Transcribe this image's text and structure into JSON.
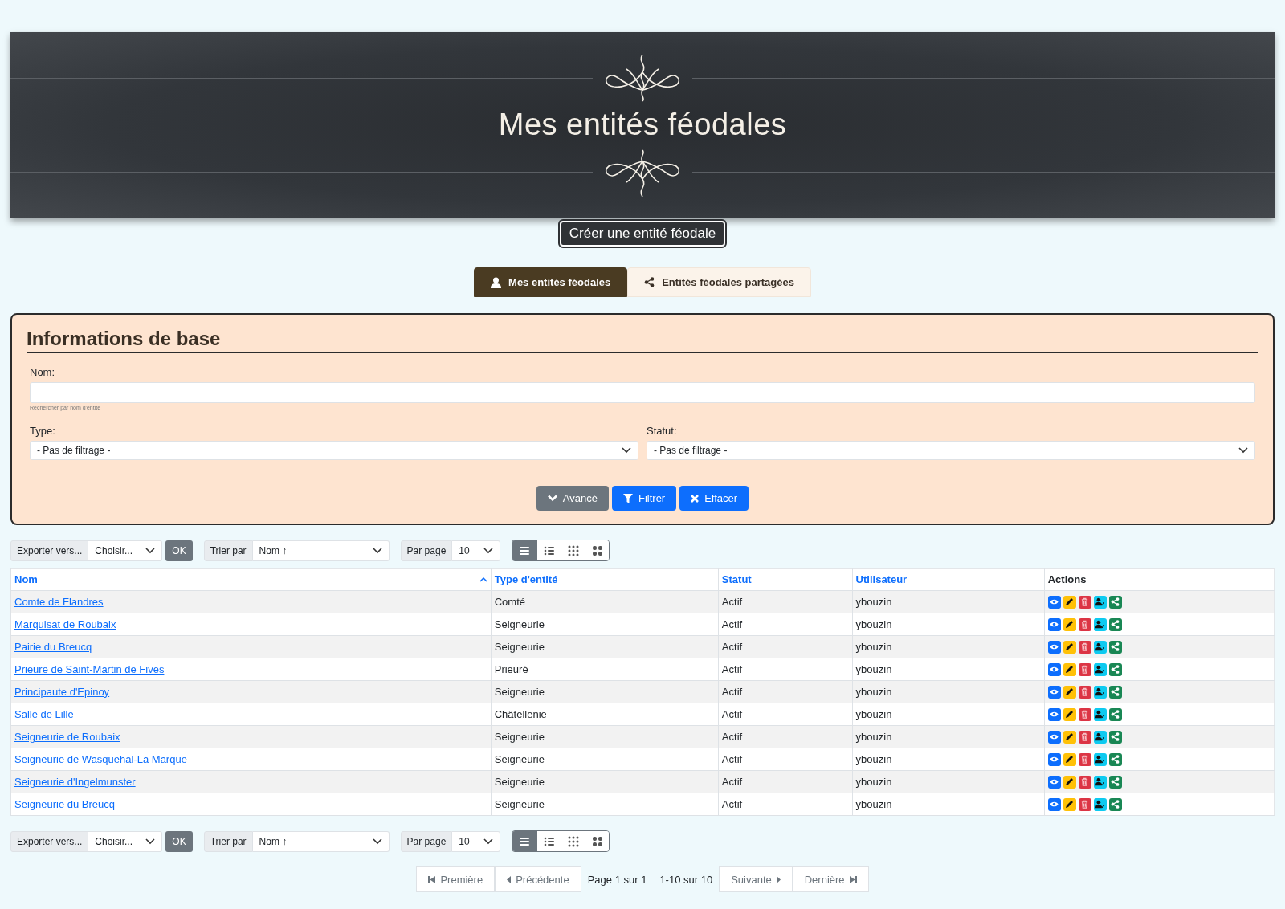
{
  "header": {
    "title": "Mes entités féodales",
    "create_button": "Créer une entité féodale"
  },
  "tabs": [
    {
      "label": "Mes entités féodales",
      "kind": "own",
      "selected": true
    },
    {
      "label": "Entités féodales partagées",
      "kind": "shared",
      "selected": false
    }
  ],
  "filter_panel": {
    "title": "Informations de base",
    "name_field": {
      "label": "Nom:",
      "help": "Rechercher par nom d'entité"
    },
    "type_field": {
      "label": "Type:",
      "value": "- Pas de filtrage -"
    },
    "status_field": {
      "label": "Statut:",
      "value": "- Pas de filtrage -"
    },
    "buttons": [
      {
        "label": "Avancé",
        "kind": "advanced"
      },
      {
        "label": "Filtrer",
        "kind": "filter"
      },
      {
        "label": "Effacer",
        "kind": "clear"
      }
    ]
  },
  "toolbars": [
    {
      "export_label": "Exporter vers...",
      "export_value": "Choisir...",
      "ok": "OK",
      "sort_label": "Trier par",
      "sort_value": "Nom ↑",
      "per_page_label": "Par page",
      "per_page_value": "10",
      "view_modes": [
        {
          "kind": "lines",
          "selected": true
        },
        {
          "kind": "list",
          "selected": false
        },
        {
          "kind": "grid-small",
          "selected": false
        },
        {
          "kind": "grid-large",
          "selected": false
        }
      ]
    },
    {
      "export_label": "Exporter vers...",
      "export_value": "Choisir...",
      "ok": "OK",
      "sort_label": "Trier par",
      "sort_value": "Nom ↑",
      "per_page_label": "Par page",
      "per_page_value": "10",
      "view_modes": [
        {
          "kind": "lines",
          "selected": true
        },
        {
          "kind": "list",
          "selected": false
        },
        {
          "kind": "grid-small",
          "selected": false
        },
        {
          "kind": "grid-large",
          "selected": false
        }
      ]
    }
  ],
  "table": {
    "columns": [
      {
        "label": "Nom",
        "sorted": true
      },
      {
        "label": "Type d'entité",
        "sorted": false
      },
      {
        "label": "Statut",
        "sorted": false
      },
      {
        "label": "Utilisateur",
        "sorted": false
      },
      {
        "label": "Actions",
        "sorted": false
      }
    ],
    "rows": [
      {
        "name": "Comte de Flandres",
        "type": "Comté",
        "status": "Actif",
        "user": "ybouzin"
      },
      {
        "name": "Marquisat de Roubaix",
        "type": "Seigneurie",
        "status": "Actif",
        "user": "ybouzin"
      },
      {
        "name": "Pairie du Breucq",
        "type": "Seigneurie",
        "status": "Actif",
        "user": "ybouzin"
      },
      {
        "name": "Prieure de Saint-Martin de Fives",
        "type": "Prieuré",
        "status": "Actif",
        "user": "ybouzin"
      },
      {
        "name": "Principaute d'Epinoy",
        "type": "Seigneurie",
        "status": "Actif",
        "user": "ybouzin"
      },
      {
        "name": "Salle de Lille",
        "type": "Châtellenie",
        "status": "Actif",
        "user": "ybouzin"
      },
      {
        "name": "Seigneurie de Roubaix",
        "type": "Seigneurie",
        "status": "Actif",
        "user": "ybouzin"
      },
      {
        "name": "Seigneurie de Wasquehal-La Marque",
        "type": "Seigneurie",
        "status": "Actif",
        "user": "ybouzin"
      },
      {
        "name": "Seigneurie d'Ingelmunster",
        "type": "Seigneurie",
        "status": "Actif",
        "user": "ybouzin"
      },
      {
        "name": "Seigneurie du Breucq",
        "type": "Seigneurie",
        "status": "Actif",
        "user": "ybouzin"
      }
    ]
  },
  "pagination": [
    {
      "label": "Première",
      "kind": "first",
      "disabled": true
    },
    {
      "label": "Précédente",
      "kind": "prev",
      "disabled": true
    },
    {
      "label": "Page 1 sur 1",
      "kind": "info",
      "disabled": false
    },
    {
      "label": "1-10 sur 10",
      "kind": "info",
      "disabled": false
    },
    {
      "label": "Suivante",
      "kind": "next",
      "disabled": true
    },
    {
      "label": "Dernière",
      "kind": "last",
      "disabled": true
    }
  ]
}
